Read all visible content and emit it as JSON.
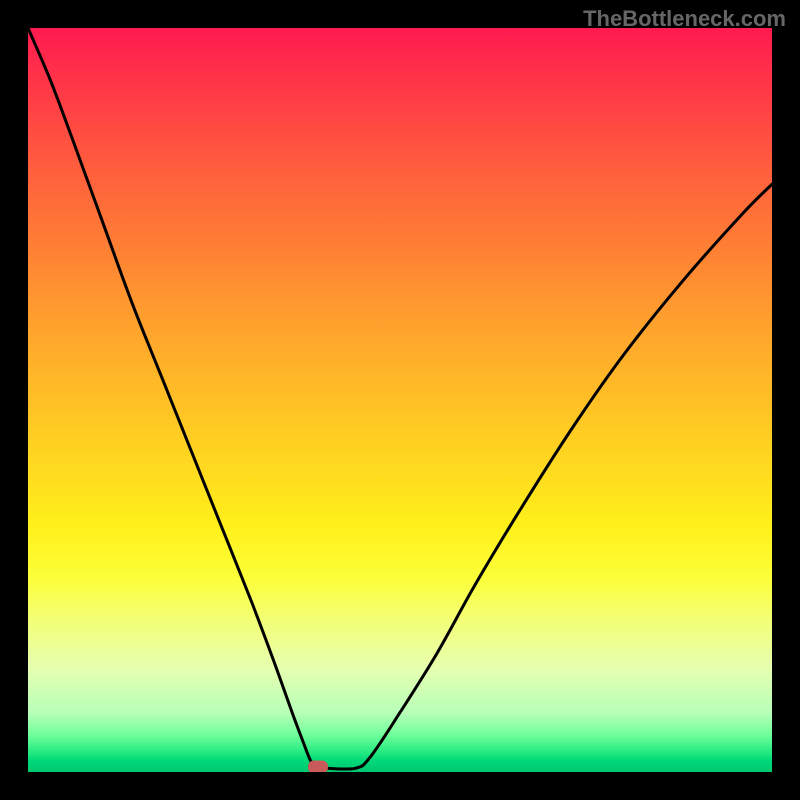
{
  "watermark": "TheBottleneck.com",
  "chart_data": {
    "type": "line",
    "title": "",
    "xlabel": "",
    "ylabel": "",
    "xlim": [
      0,
      100
    ],
    "ylim": [
      0,
      100
    ],
    "grid": false,
    "series": [
      {
        "name": "bottleneck-curve",
        "x": [
          0,
          3,
          6,
          10,
          14,
          18,
          22,
          26,
          30,
          33,
          35.5,
          37,
          38,
          39,
          40,
          44,
          46,
          50,
          55,
          60,
          66,
          73,
          80,
          88,
          96,
          100
        ],
        "y": [
          100,
          93,
          85,
          74,
          63,
          53,
          43,
          33,
          23,
          15,
          8,
          4,
          1.5,
          0.5,
          0.5,
          0.5,
          2,
          8,
          16,
          25,
          35,
          46,
          56,
          66,
          75,
          79
        ],
        "color": "#000000"
      }
    ],
    "marker": {
      "cx": 39.0,
      "cy": 0.7,
      "color": "#c85a5a"
    },
    "notch": {
      "x_range": [
        37.5,
        44.5
      ],
      "y": 0.5
    },
    "background_gradient": {
      "top": "#ff1a50",
      "mid": "#ffe030",
      "bottom": "#00d070"
    }
  }
}
